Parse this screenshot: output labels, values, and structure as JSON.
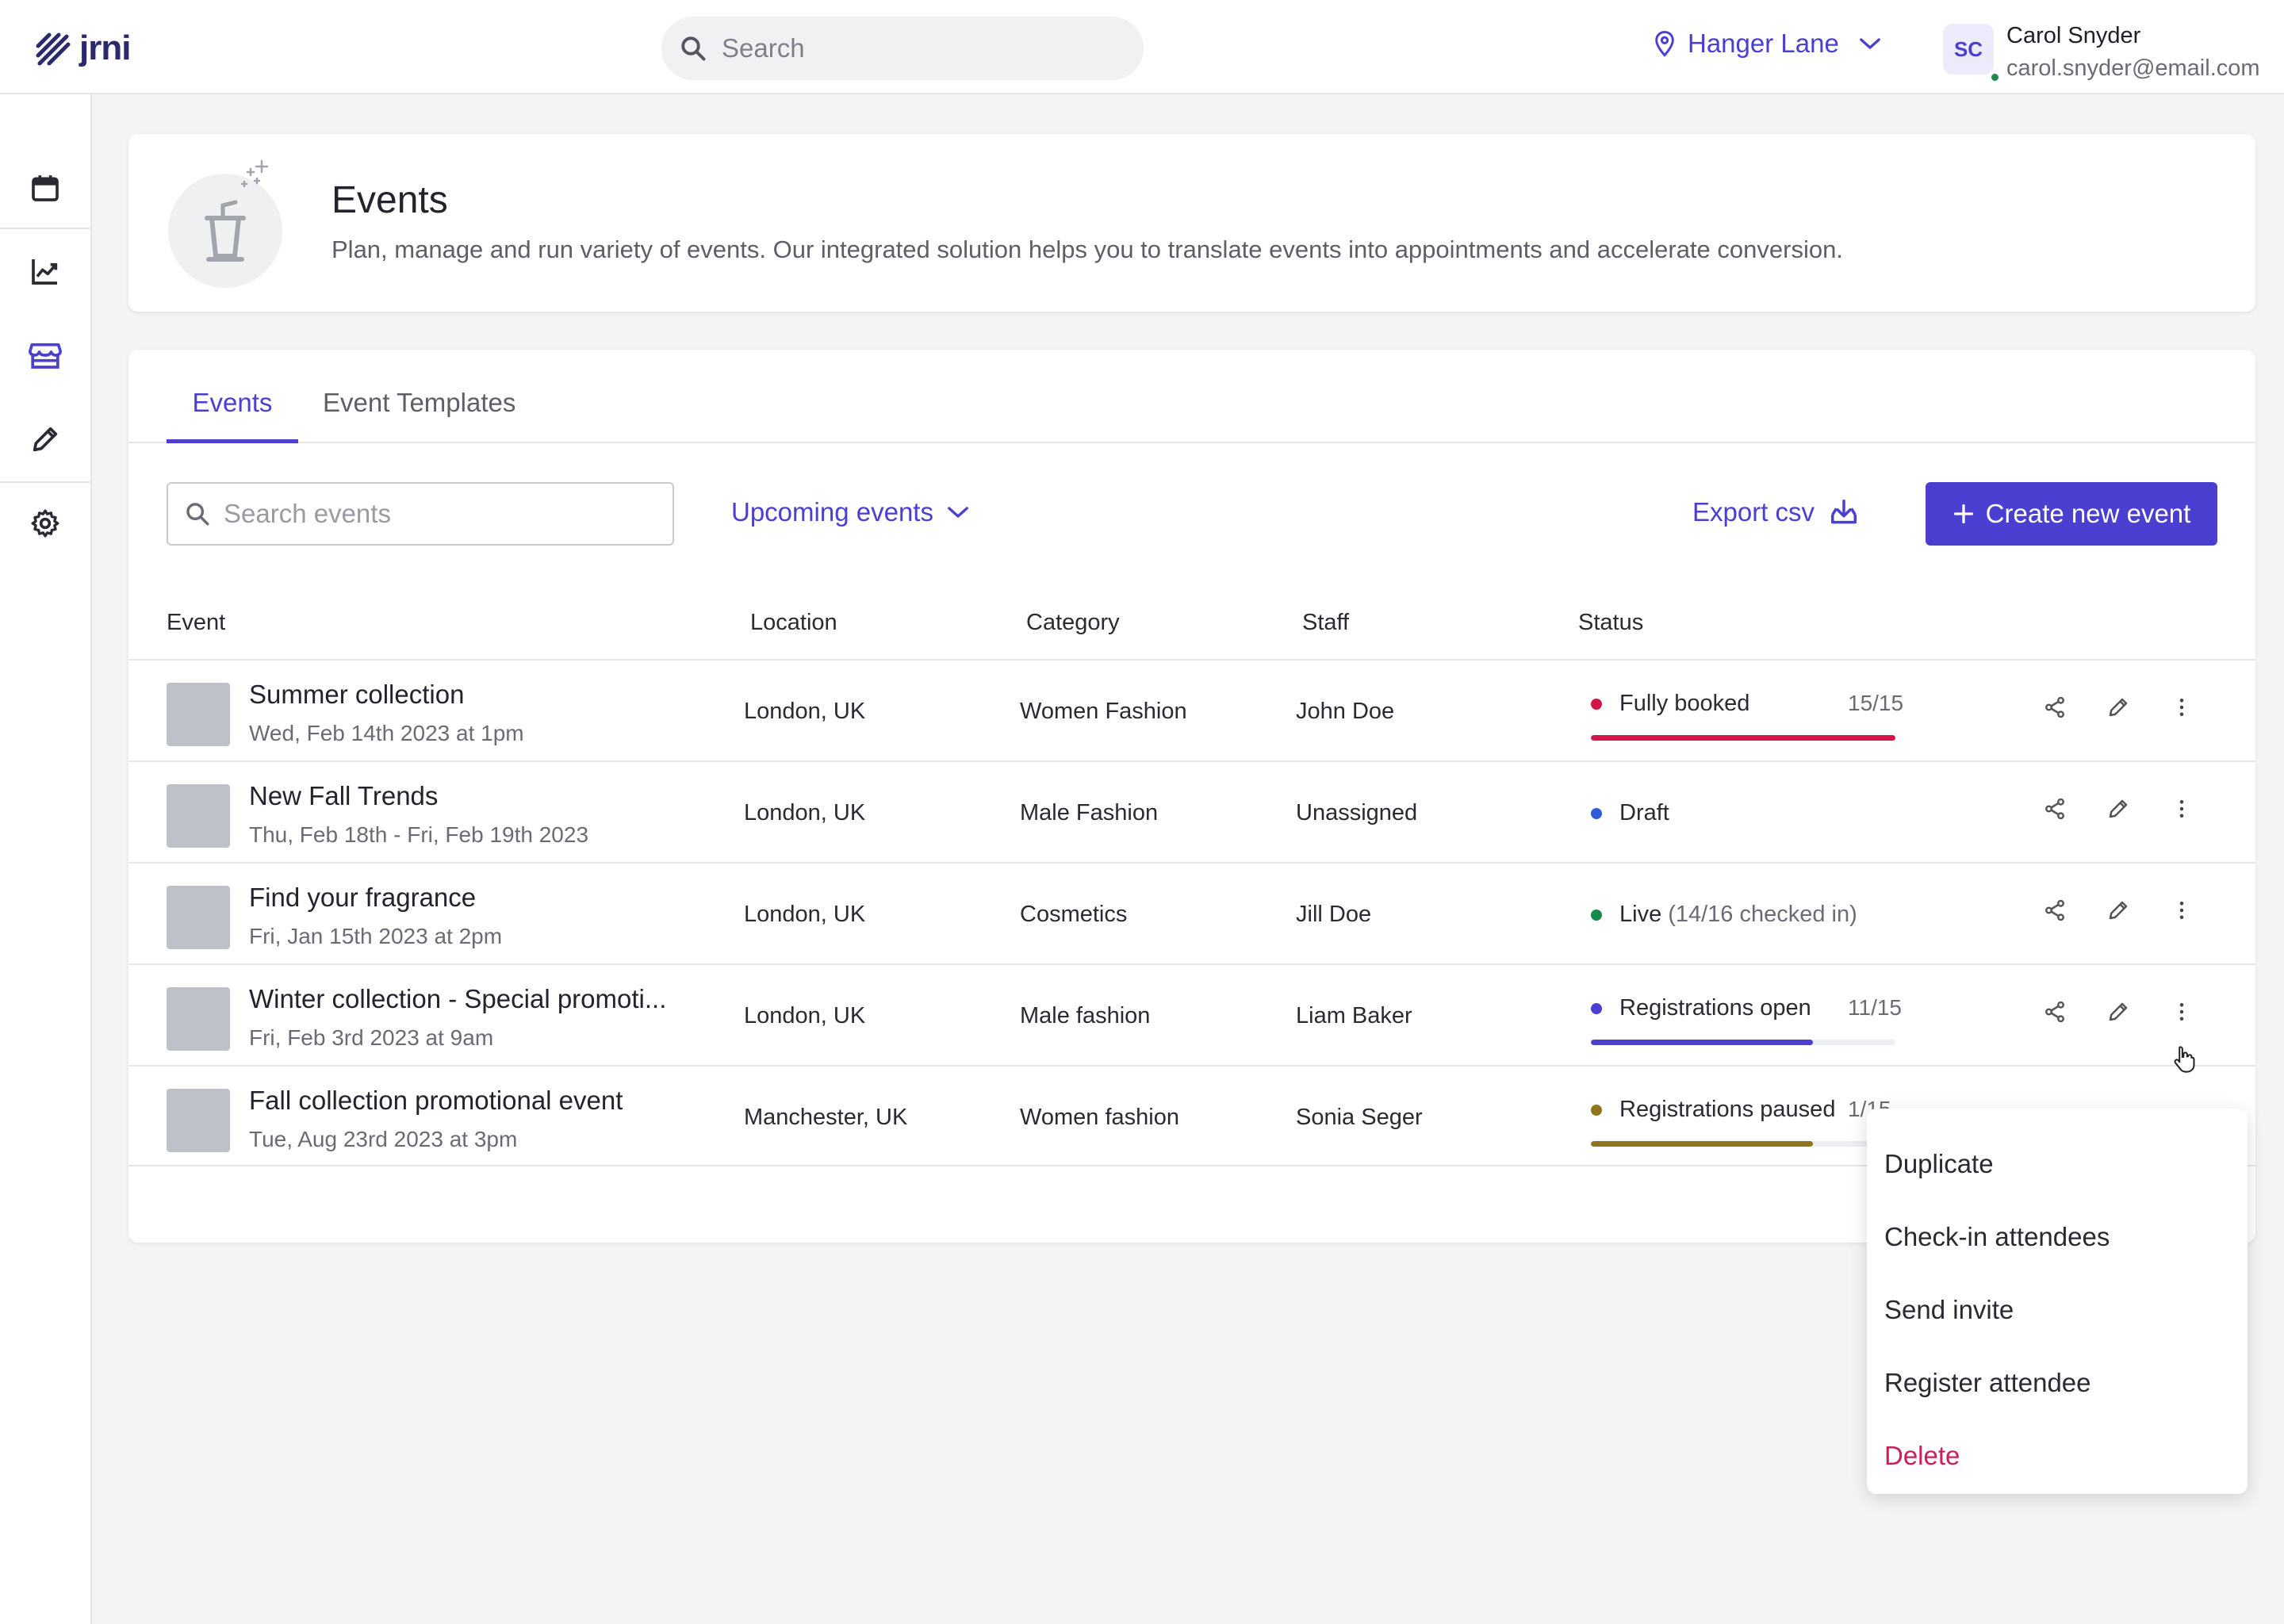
{
  "app": {
    "logo_text": "jrni"
  },
  "topbar": {
    "search_placeholder": "Search",
    "location": "Hanger Lane",
    "user": {
      "initials": "SC",
      "name": "Carol Snyder",
      "email": "carol.snyder@email.com"
    }
  },
  "sidebar": {
    "items": [
      {
        "icon": "calendar-icon"
      },
      {
        "icon": "chart-icon"
      },
      {
        "icon": "store-icon",
        "active": true
      },
      {
        "icon": "pencil-icon"
      },
      {
        "icon": "gear-icon"
      }
    ]
  },
  "header": {
    "title": "Events",
    "subtitle": "Plan, manage and run variety of events. Our integrated solution helps you to translate events into appointments and accelerate conversion."
  },
  "tabs": [
    {
      "label": "Events",
      "active": true
    },
    {
      "label": "Event Templates",
      "active": false
    }
  ],
  "toolbar": {
    "search_placeholder": "Search events",
    "filter_label": "Upcoming events",
    "export_label": "Export csv",
    "create_label": "Create new event"
  },
  "table": {
    "columns": [
      "Event",
      "Location",
      "Category",
      "Staff",
      "Status"
    ],
    "rows": [
      {
        "title": "Summer collection",
        "date": "Wed, Feb 14th 2023 at 1pm",
        "location": "London, UK",
        "category": "Women Fashion",
        "staff": "John Doe",
        "status": "Fully booked",
        "status_extra": "",
        "count": "15/15",
        "progress": 1.0,
        "color": "#d4154a"
      },
      {
        "title": "New Fall Trends",
        "date": "Thu, Feb 18th - Fri, Feb 19th 2023",
        "location": "London, UK",
        "category": "Male Fashion",
        "staff": "Unassigned",
        "status": "Draft",
        "status_extra": "",
        "count": "",
        "progress": null,
        "color": "#2e5bd6"
      },
      {
        "title": "Find your fragrance",
        "date": "Fri, Jan 15th 2023 at 2pm",
        "location": "London, UK",
        "category": "Cosmetics",
        "staff": "Jill Doe",
        "status": "Live",
        "status_extra": "(14/16 checked in)",
        "count": "",
        "progress": null,
        "color": "#178a4a"
      },
      {
        "title": "Winter collection - Special promoti...",
        "date": "Fri, Feb 3rd 2023 at 9am",
        "location": "London, UK",
        "category": "Male fashion",
        "staff": "Liam Baker",
        "status": "Registrations open",
        "status_extra": "",
        "count": "11/15",
        "progress": 0.73,
        "color": "#4a3fd1"
      },
      {
        "title": "Fall collection promotional event",
        "date": "Tue, Aug 23rd 2023 at 3pm",
        "location": "Manchester, UK",
        "category": "Women fashion",
        "staff": "Sonia Seger",
        "status": "Registrations paused",
        "status_extra": "",
        "count": "1/15",
        "progress": 0.73,
        "color": "#8f7418"
      }
    ]
  },
  "context_menu": {
    "items": [
      {
        "label": "Duplicate"
      },
      {
        "label": "Check-in attendees"
      },
      {
        "label": "Send invite"
      },
      {
        "label": "Register attendee"
      },
      {
        "label": "Delete",
        "danger": true
      }
    ]
  },
  "colors": {
    "accent": "#4a3fd1",
    "danger": "#cf1d5a"
  }
}
